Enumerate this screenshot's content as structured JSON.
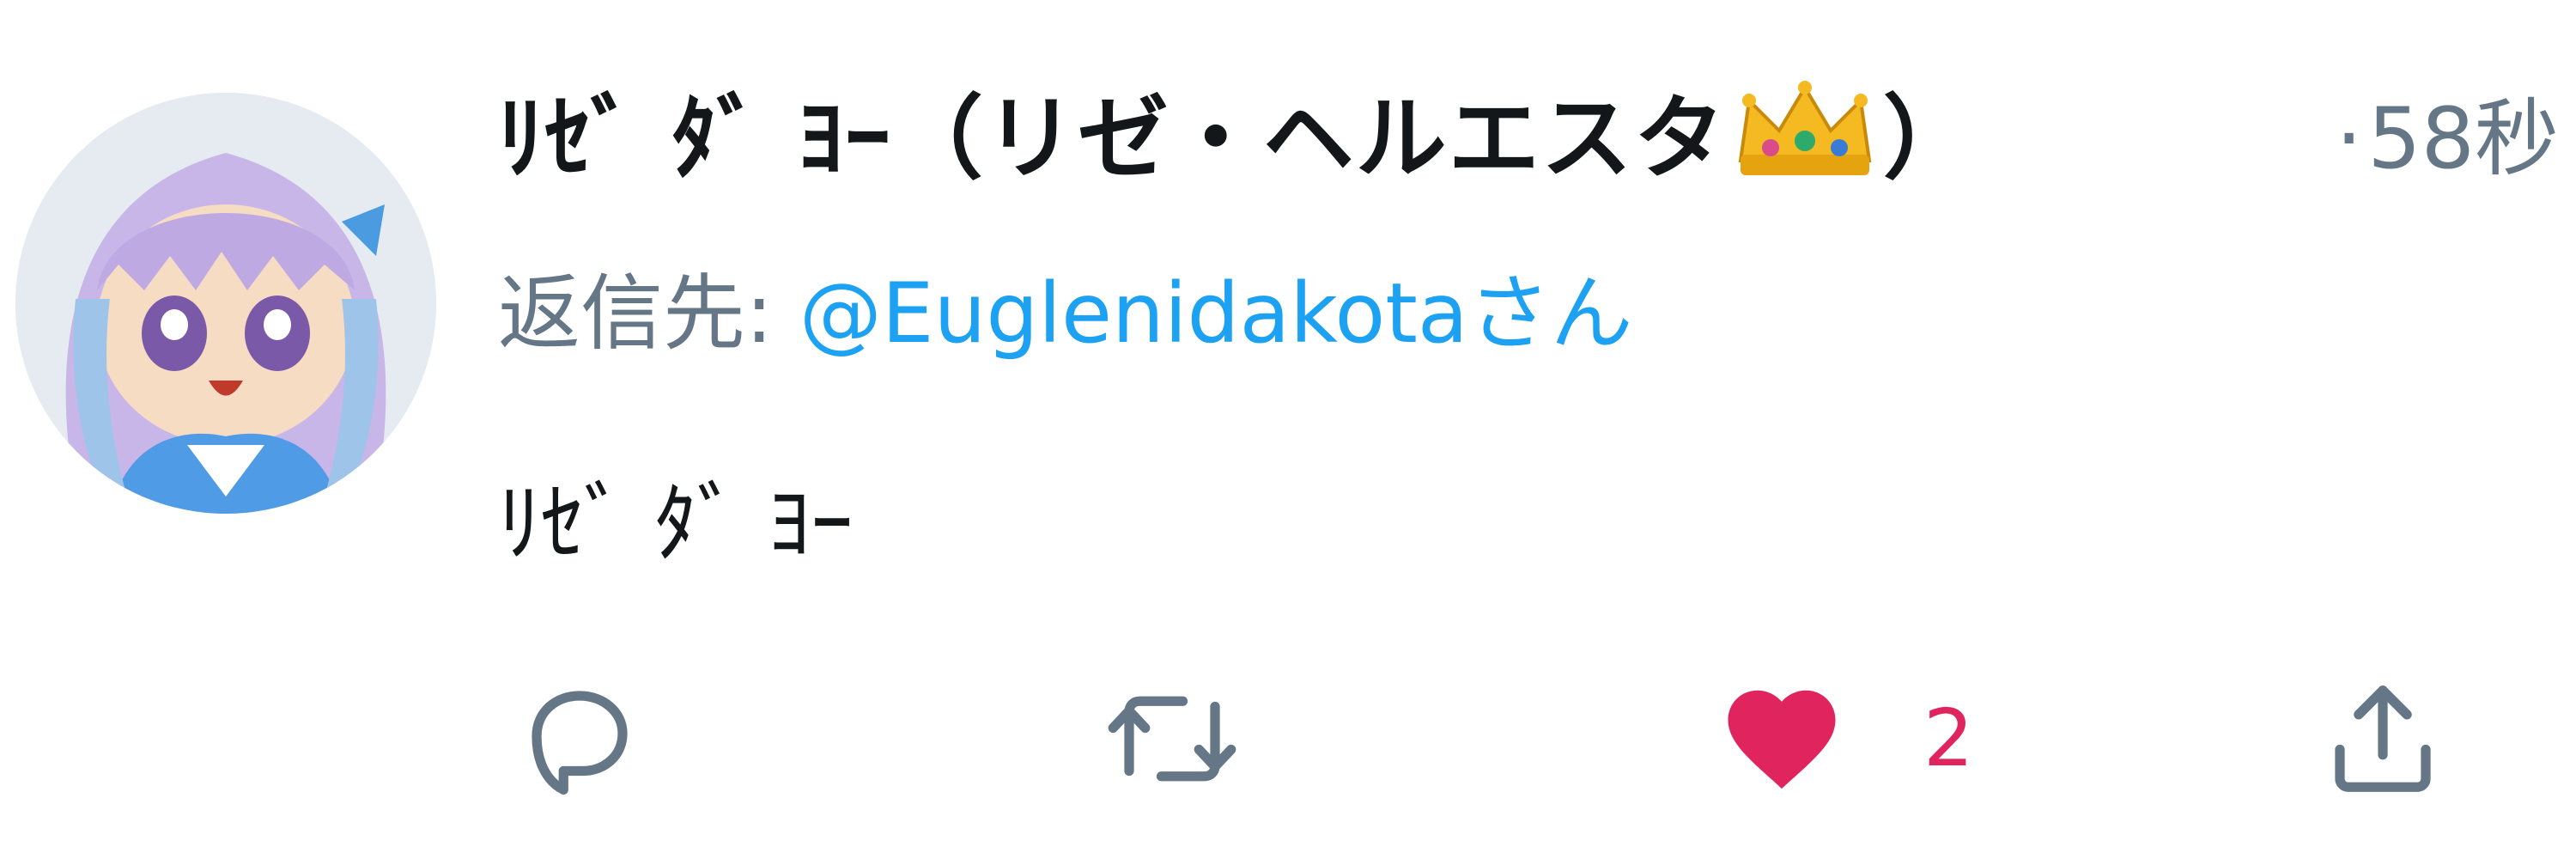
{
  "tweet": {
    "display_name_before": "ﾘｾﾞ ﾀﾞ ﾖｰ（リゼ・ヘルエスタ",
    "display_name_after": "）",
    "crown_emoji": "crown-emoji",
    "timestamp_dot": "·",
    "timestamp": "58秒",
    "reply_prefix": "返信先: ",
    "reply_mention": "@Euglenidakota",
    "reply_suffix": "さん",
    "text": "ﾘｾﾞ ﾀﾞ ﾖｰ"
  },
  "actions": {
    "reply_icon": "reply-icon",
    "retweet_icon": "retweet-icon",
    "like_icon": "heart-icon",
    "like_count": "2",
    "share_icon": "share-icon"
  },
  "colors": {
    "text_primary": "#14171a",
    "text_secondary": "#657786",
    "link": "#1da1f2",
    "like": "#e0245e"
  }
}
